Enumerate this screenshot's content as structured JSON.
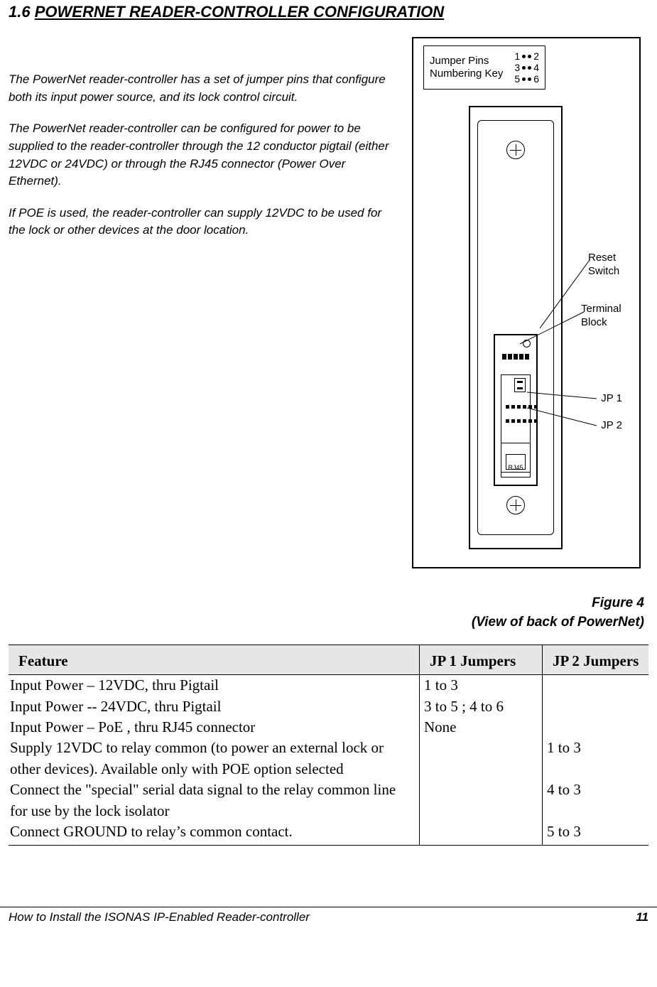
{
  "section": {
    "number": "1.6",
    "title": "POWERNET READER-CONTROLLER CONFIGURATION"
  },
  "intro": {
    "p1": "The PowerNet reader-controller has a set of jumper pins that configure both its input power source, and its lock control circuit.",
    "p2": "The PowerNet reader-controller can be configured for power to be supplied to the reader-controller through the 12 conductor pigtail (either 12VDC or 24VDC) or through the RJ45 connector (Power Over Ethernet).",
    "p3": "If POE is used, the reader-controller can supply 12VDC to be used for the lock or other devices at the door location."
  },
  "diagram": {
    "key_title_l1": "Jumper Pins",
    "key_title_l2": "Numbering Key",
    "pins": [
      "1",
      "2",
      "3",
      "4",
      "5",
      "6"
    ],
    "labels": {
      "reset": "Reset Switch",
      "terminal": "Terminal Block",
      "jp1": "JP 1",
      "jp2": "JP 2",
      "rj45": "RJ45"
    }
  },
  "figure": {
    "line1": "Figure 4",
    "line2": "(View of back of PowerNet)"
  },
  "table": {
    "headers": [
      "Feature",
      "JP 1 Jumpers",
      "JP 2 Jumpers"
    ],
    "rows": [
      {
        "feature": "Input Power – 12VDC, thru Pigtail",
        "jp1": "1 to 3",
        "jp2": ""
      },
      {
        "feature": "Input Power -- 24VDC, thru Pigtail",
        "jp1": "3 to 5 ; 4 to 6",
        "jp2": ""
      },
      {
        "feature": "Input Power – PoE , thru RJ45 connector",
        "jp1": "None",
        "jp2": ""
      },
      {
        "feature": "Supply 12VDC to relay common (to power an external lock or other devices). Available only with POE option selected",
        "jp1": "",
        "jp2": "1 to 3"
      },
      {
        "feature": "Connect the \"special\" serial data signal to the relay common line for use by the lock isolator",
        "jp1": "",
        "jp2": "4 to 3"
      },
      {
        "feature": "Connect GROUND to relay’s common contact.",
        "jp1": "",
        "jp2": "5 to 3"
      }
    ]
  },
  "footer": {
    "title": "How to Install the ISONAS IP-Enabled Reader-controller",
    "page": "11"
  }
}
